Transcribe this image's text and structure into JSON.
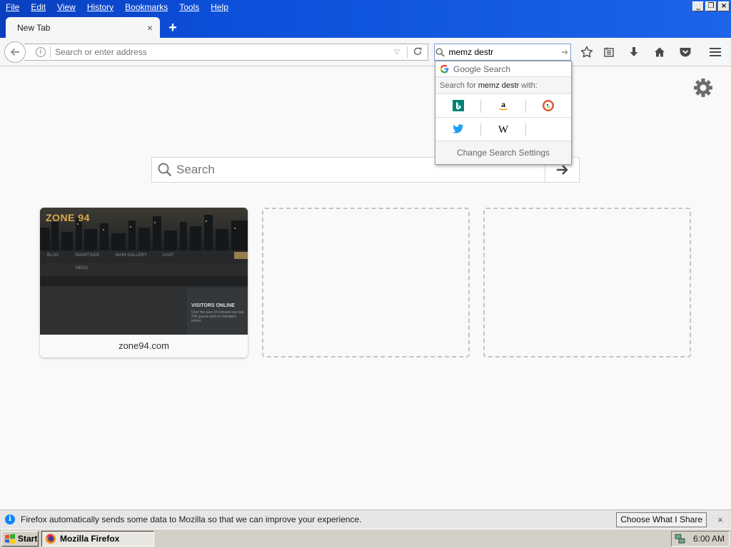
{
  "menu": {
    "items": [
      "File",
      "Edit",
      "View",
      "History",
      "Bookmarks",
      "Tools",
      "Help"
    ]
  },
  "window": {
    "minimize": "_",
    "restore": "❐",
    "close": "×"
  },
  "tab": {
    "title": "New Tab",
    "close": "×",
    "new_tab": "+"
  },
  "urlbar": {
    "placeholder": "Search or enter address",
    "value": ""
  },
  "searchbar": {
    "value": "memz destr"
  },
  "search_popup": {
    "google_suggestion": "Google Search",
    "header_prefix": "Search for",
    "header_query": "memz destr",
    "header_suffix": "with:",
    "engines_row1": [
      "bing-icon",
      "amazon-icon",
      "duckduckgo-icon"
    ],
    "engines_row2": [
      "twitter-icon",
      "wikipedia-icon"
    ],
    "settings_label": "Change Search Settings"
  },
  "content": {
    "search_placeholder": "Search",
    "tiles": [
      {
        "title": "zone94.com",
        "has_thumbnail": true
      },
      {
        "title": "",
        "has_thumbnail": false
      },
      {
        "title": "",
        "has_thumbnail": false
      }
    ]
  },
  "thumbnail": {
    "logo": "ZONE 94",
    "nav": [
      "BLOG",
      "SMARTSIDE",
      "MAIN GALLERY",
      "CHAT",
      "MENU"
    ],
    "widget_title": "VISITORS ONLINE",
    "widget_text": "Over the past 15 minutes we had 204 guests and no members online."
  },
  "notification": {
    "text": "Firefox automatically sends some data to Mozilla so that we can improve your experience.",
    "button": "Choose What I Share",
    "close": "×"
  },
  "taskbar": {
    "start": "Start",
    "task": "Mozilla Firefox",
    "clock": "6:00 AM"
  },
  "colors": {
    "titlebar": "#0c4fd9",
    "accent": "#0a84ff",
    "taskbar": "#d4d0c8"
  }
}
